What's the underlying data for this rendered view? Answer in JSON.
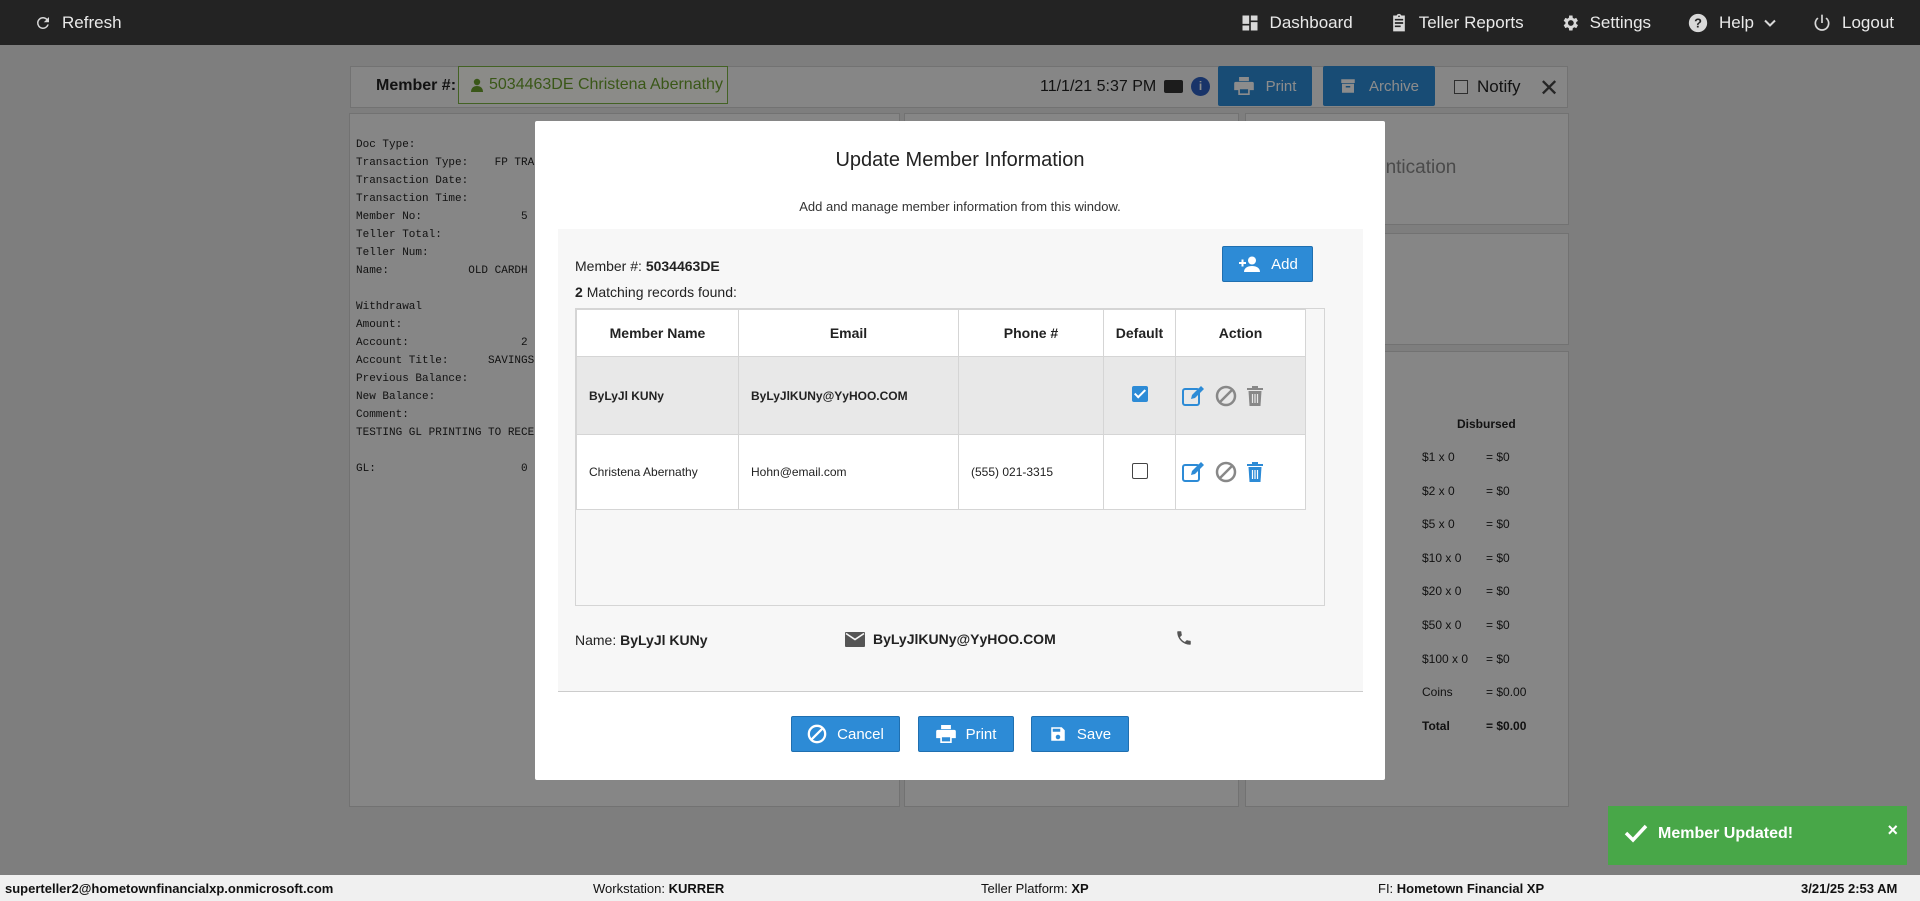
{
  "topbar": {
    "refresh_label": "Refresh",
    "nav": [
      {
        "label": "Dashboard",
        "icon": "dashboard-icon"
      },
      {
        "label": "Teller Reports",
        "icon": "clipboard-icon"
      },
      {
        "label": "Settings",
        "icon": "gear-icon"
      },
      {
        "label": "Help",
        "icon": "help-icon"
      },
      {
        "label": "Logout",
        "icon": "power-icon"
      }
    ]
  },
  "member_bar": {
    "label": "Member #:",
    "member": "5034463DE Christena Abernathy",
    "timestamp": "11/1/21 5:37 PM",
    "print_label": "Print",
    "archive_label": "Archive",
    "notify_label": "Notify"
  },
  "receipt": {
    "lines": [
      "Doc Type:",
      "Transaction Type:    FP TRA",
      "Transaction Date:",
      "Transaction Time:",
      "Member No:               5",
      "Teller Total:",
      "Teller Num:",
      "Name:            OLD CARDH",
      "",
      "Withdrawal",
      "Amount:",
      "Account:                 2",
      "Account Title:      SAVINGS",
      "Previous Balance:",
      "New Balance:",
      "Comment:",
      "TESTING GL PRINTING TO RECE",
      "",
      "GL:                      0"
    ]
  },
  "auth_panel": {
    "text": "entication"
  },
  "disbursed": {
    "header": "Disbursed",
    "rows": [
      {
        "denom": "$1 x 0",
        "value": "= $0"
      },
      {
        "denom": "$2 x 0",
        "value": "= $0"
      },
      {
        "denom": "$5 x 0",
        "value": "= $0"
      },
      {
        "denom": "$10 x 0",
        "value": "= $0"
      },
      {
        "denom": "$20 x 0",
        "value": "= $0"
      },
      {
        "denom": "$50 x 0",
        "value": "= $0"
      },
      {
        "denom": "$100 x 0",
        "value": "= $0"
      },
      {
        "denom": "Coins",
        "value": "= $0.00"
      },
      {
        "denom": "Total",
        "value": "= $0.00"
      }
    ]
  },
  "modal": {
    "title": "Update Member Information",
    "subtitle": "Add and manage member information from this window.",
    "member_label": "Member #:",
    "member_number": "5034463DE",
    "match_count": "2",
    "match_text": "Matching records found:",
    "add_label": "Add",
    "columns": [
      "Member Name",
      "Email",
      "Phone #",
      "Default",
      "Action"
    ],
    "rows": [
      {
        "name": "ByLyJl KUNy",
        "email": "ByLyJlKUNy@YyHOO.COM",
        "phone": "",
        "default": true
      },
      {
        "name": "Christena Abernathy",
        "email": "Hohn@email.com",
        "phone": "(555) 021-3315",
        "default": false
      }
    ],
    "detail": {
      "name_label": "Name:",
      "name": "ByLyJl KUNy",
      "email": "ByLyJlKUNy@YyHOO.COM"
    },
    "buttons": {
      "cancel": "Cancel",
      "print": "Print",
      "save": "Save"
    }
  },
  "toast": {
    "message": "Member Updated!",
    "close": "×"
  },
  "footer": {
    "user": "superteller2@hometownfinancialxp.onmicrosoft.com",
    "workstation_label": "Workstation:",
    "workstation": "KURRER",
    "platform_label": "Teller Platform:",
    "platform": "XP",
    "fi_label": "FI:",
    "fi": "Hometown Financial XP",
    "datetime": "3/21/25 2:53 AM"
  },
  "colors": {
    "accent": "#2d8bd6",
    "topbar": "#232323",
    "success": "#48a748",
    "member_chip": "#6a9f2c"
  }
}
